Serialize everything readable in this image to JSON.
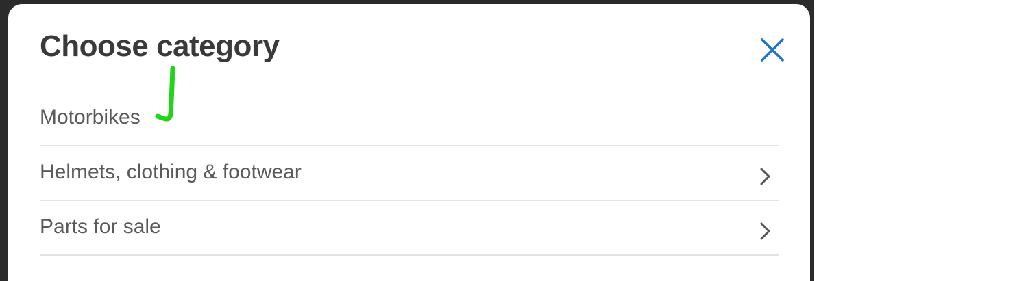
{
  "dialog": {
    "title": "Choose category",
    "close_icon": "close-icon",
    "accent_color": "#1a73c8"
  },
  "categories": [
    {
      "label": "Motorbikes",
      "has_submenu": false,
      "annotation": "green-checkmark"
    },
    {
      "label": "Helmets, clothing & footwear",
      "has_submenu": true,
      "icon": "chevron-right-icon"
    },
    {
      "label": "Parts for sale",
      "has_submenu": true,
      "icon": "chevron-right-icon"
    }
  ],
  "annotation_color": "#22d41a"
}
